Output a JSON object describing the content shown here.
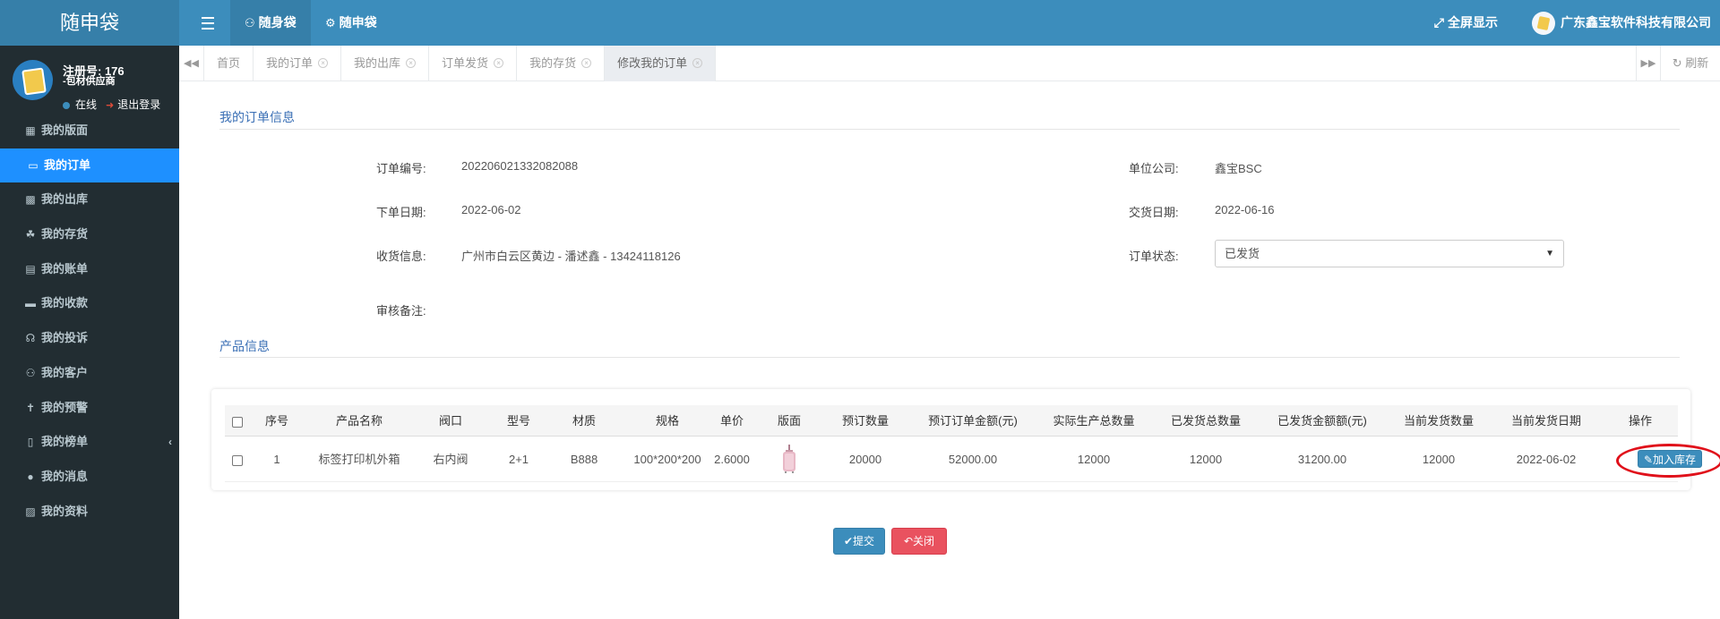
{
  "brand": "随申袋",
  "top_tabs": [
    {
      "label": "随身袋",
      "icon": "users-icon"
    },
    {
      "label": "随申袋",
      "icon": "gear-icon"
    }
  ],
  "fullscreen_label": "全屏显示",
  "company_name": "广东鑫宝软件科技有限公司",
  "user": {
    "name": "注册号: 176",
    "role": "-包材供应商",
    "status": "在线",
    "logout": "退出登录"
  },
  "menu": [
    {
      "label": "我的版面",
      "icon": "sitemap-icon"
    },
    {
      "label": "我的订单",
      "icon": "desktop-icon"
    },
    {
      "label": "我的出库",
      "icon": "bus-icon"
    },
    {
      "label": "我的存货",
      "icon": "cubes-icon"
    },
    {
      "label": "我的账单",
      "icon": "money-icon"
    },
    {
      "label": "我的收款",
      "icon": "credit-card-icon"
    },
    {
      "label": "我的投诉",
      "icon": "headphones-icon"
    },
    {
      "label": "我的客户",
      "icon": "users-icon"
    },
    {
      "label": "我的预警",
      "icon": "bell-slash-icon"
    },
    {
      "label": "我的榜单",
      "icon": "bar-chart-icon"
    },
    {
      "label": "我的消息",
      "icon": "globe-icon"
    },
    {
      "label": "我的资料",
      "icon": "id-card-icon"
    }
  ],
  "tabs": [
    "首页",
    "我的订单",
    "我的出库",
    "订单发货",
    "我的存货",
    "修改我的订单"
  ],
  "refresh_label": "刷新",
  "order_section_title": "我的订单信息",
  "product_section_title": "产品信息",
  "order": {
    "order_no_label": "订单编号:",
    "order_no": "202206021332082088",
    "company_label": "单位公司:",
    "company": "鑫宝BSC",
    "order_date_label": "下单日期:",
    "order_date": "2022-06-02",
    "delivery_date_label": "交货日期:",
    "delivery_date": "2022-06-16",
    "shipping_label": "收货信息:",
    "shipping": "广州市白云区黄边 - 潘述鑫 - 13424118126",
    "status_label": "订单状态:",
    "status": "已发货",
    "review_label": "审核备注:"
  },
  "table": {
    "headers": [
      "序号",
      "产品名称",
      "阀口",
      "型号",
      "材质",
      "规格",
      "单价",
      "版面",
      "预订数量",
      "预订订单金额(元)",
      "实际生产总数量",
      "已发货总数量",
      "已发货金额额(元)",
      "当前发货数量",
      "当前发货日期",
      "操作"
    ],
    "rows": [
      [
        "1",
        "标签打印机外箱",
        "右内阀",
        "2+1",
        "B888",
        "100*200*200",
        "2.6000",
        "",
        "20000",
        "52000.00",
        "12000",
        "12000",
        "31200.00",
        "12000",
        "2022-06-02",
        "加入库存"
      ]
    ]
  },
  "buttons": {
    "submit": "提交",
    "close": "关闭"
  },
  "colors": {
    "topbar": "#3c8dbc",
    "sidebar": "#222d32",
    "active_menu": "#1e90ff",
    "highlight": "#e0101a"
  }
}
